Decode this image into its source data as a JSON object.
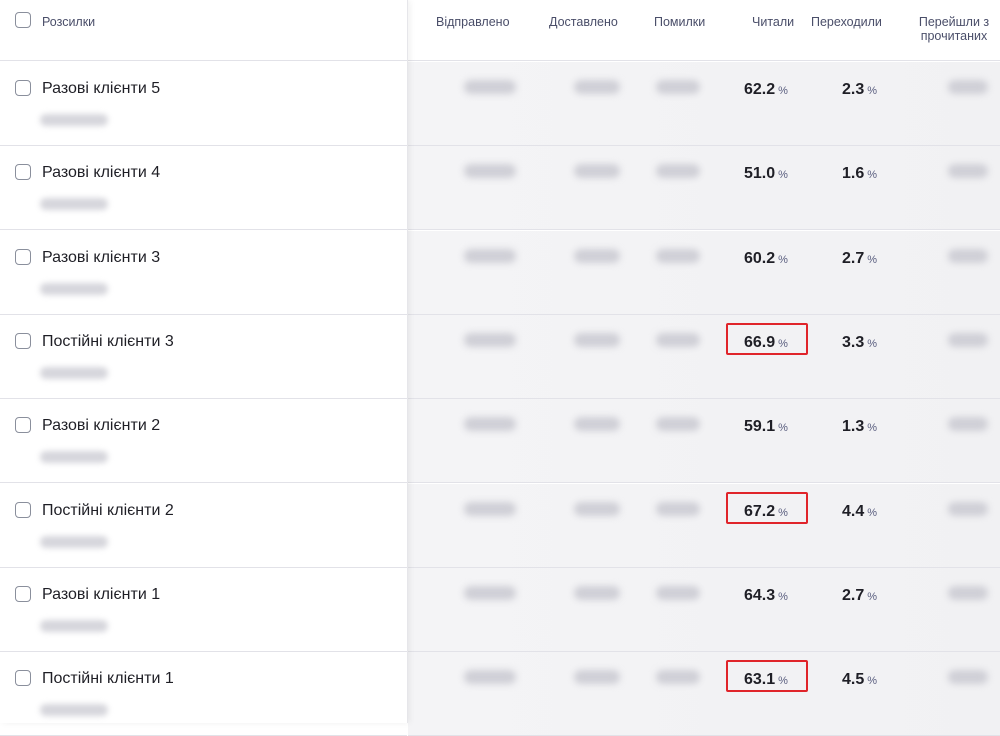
{
  "columns": {
    "campaigns": "Розсилки",
    "sent": "Відправлено",
    "delivered": "Доставлено",
    "errors": "Помилки",
    "read": "Читали",
    "clicked": "Переходили",
    "clicked_from_read_line1": "Перейшли з",
    "clicked_from_read_line2": "прочитаних"
  },
  "percent_unit": "%",
  "rows": [
    {
      "name": "Разові клієнти 5",
      "read": "62.2",
      "clicked": "2.3",
      "highlighted": false
    },
    {
      "name": "Разові клієнти 4",
      "read": "51.0",
      "clicked": "1.6",
      "highlighted": false
    },
    {
      "name": "Разові клієнти 3",
      "read": "60.2",
      "clicked": "2.7",
      "highlighted": false
    },
    {
      "name": "Постійні клієнти 3",
      "read": "66.9",
      "clicked": "3.3",
      "highlighted": true
    },
    {
      "name": "Разові клієнти 2",
      "read": "59.1",
      "clicked": "1.3",
      "highlighted": false
    },
    {
      "name": "Постійні клієнти 2",
      "read": "67.2",
      "clicked": "4.4",
      "highlighted": true
    },
    {
      "name": "Разові клієнти 1",
      "read": "64.3",
      "clicked": "2.7",
      "highlighted": false
    },
    {
      "name": "Постійні клієнти 1",
      "read": "63.1",
      "clicked": "4.5",
      "highlighted": true
    }
  ],
  "colors": {
    "highlight_border": "#e0242a",
    "header_text": "#4a4e69"
  }
}
